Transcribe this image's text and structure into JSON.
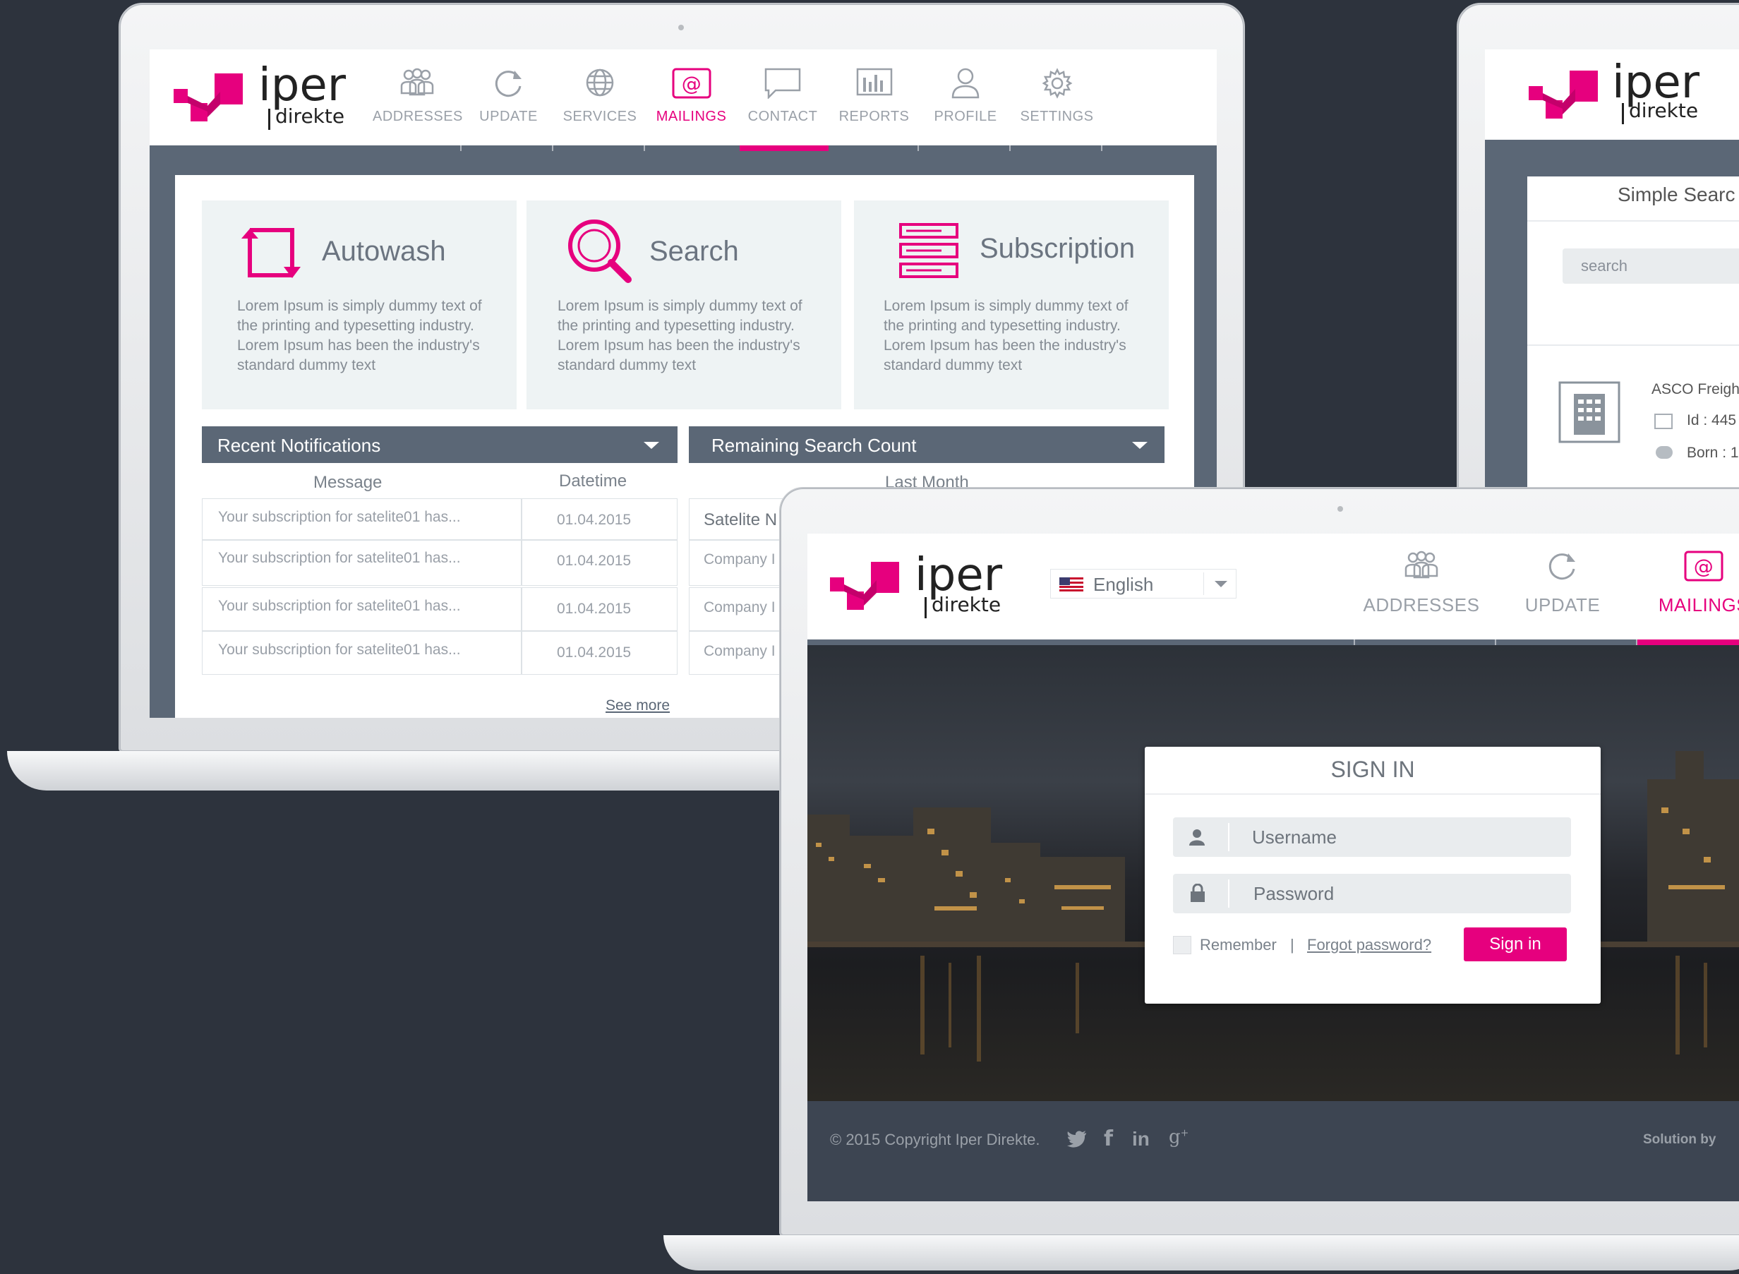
{
  "colors": {
    "accent": "#e6007e",
    "bar": "#5b6776",
    "bg": "#2d333d"
  },
  "brand": {
    "name": "iper",
    "sub": "direkte"
  },
  "laptop1": {
    "nav": [
      {
        "label": "ADDRESSES",
        "icon": "people-icon"
      },
      {
        "label": "UPDATE",
        "icon": "refresh-icon"
      },
      {
        "label": "SERVICES",
        "icon": "globe-icon"
      },
      {
        "label": "MAILINGS",
        "icon": "at-icon",
        "active": true
      },
      {
        "label": "CONTACT",
        "icon": "chat-icon"
      },
      {
        "label": "REPORTS",
        "icon": "bar-chart-icon"
      },
      {
        "label": "PROFILE",
        "icon": "user-icon"
      },
      {
        "label": "SETTINGS",
        "icon": "gear-icon"
      }
    ],
    "cards": [
      {
        "title": "Autowash",
        "icon": "autowash-icon",
        "text": "Lorem Ipsum is simply dummy text of the printing and typesetting industry. Lorem Ipsum has been the industry's standard dummy text"
      },
      {
        "title": "Search",
        "icon": "search-icon",
        "text": "Lorem Ipsum is simply dummy text of the printing and typesetting industry. Lorem Ipsum has been the industry's standard dummy text"
      },
      {
        "title": "Subscription",
        "icon": "subscription-icon",
        "text": "Lorem Ipsum is simply dummy text of the printing and typesetting industry. Lorem Ipsum has been the industry's standard dummy text"
      }
    ],
    "notifications": {
      "title": "Recent Notifications",
      "col_message": "Message",
      "col_datetime": "Datetime",
      "rows": [
        {
          "message": "Your subscription for satelite01 has...",
          "date": "01.04.2015"
        },
        {
          "message": "Your subscription for satelite01 has...",
          "date": "01.04.2015"
        },
        {
          "message": "Your subscription for satelite01 has...",
          "date": "01.04.2015"
        },
        {
          "message": "Your subscription for satelite01 has...",
          "date": "01.04.2015"
        }
      ],
      "see_more": "See more"
    },
    "search_count": {
      "title": "Remaining Search Count",
      "col": "Last Month",
      "rows": [
        "Satelite N",
        "Company I",
        "Company I",
        "Company I"
      ]
    }
  },
  "laptop2": {
    "panel_title": "Simple Searc",
    "search_placeholder": "search",
    "company": "ASCO Freigh",
    "id_label": "Id : 445",
    "born_label": "Born : 1"
  },
  "laptop3": {
    "language": "English",
    "nav": [
      {
        "label": "ADDRESSES",
        "icon": "people-icon"
      },
      {
        "label": "UPDATE",
        "icon": "refresh-icon"
      },
      {
        "label": "MAILINGS",
        "icon": "at-icon",
        "active": true
      }
    ],
    "signin": {
      "title": "SIGN IN",
      "username_placeholder": "Username",
      "password_placeholder": "Password",
      "remember": "Remember",
      "divider": "|",
      "forgot": "Forgot password?",
      "button": "Sign in"
    },
    "footer": {
      "copyright": "© 2015 Copyright Iper Direkte.",
      "solution": "Solution by"
    }
  }
}
